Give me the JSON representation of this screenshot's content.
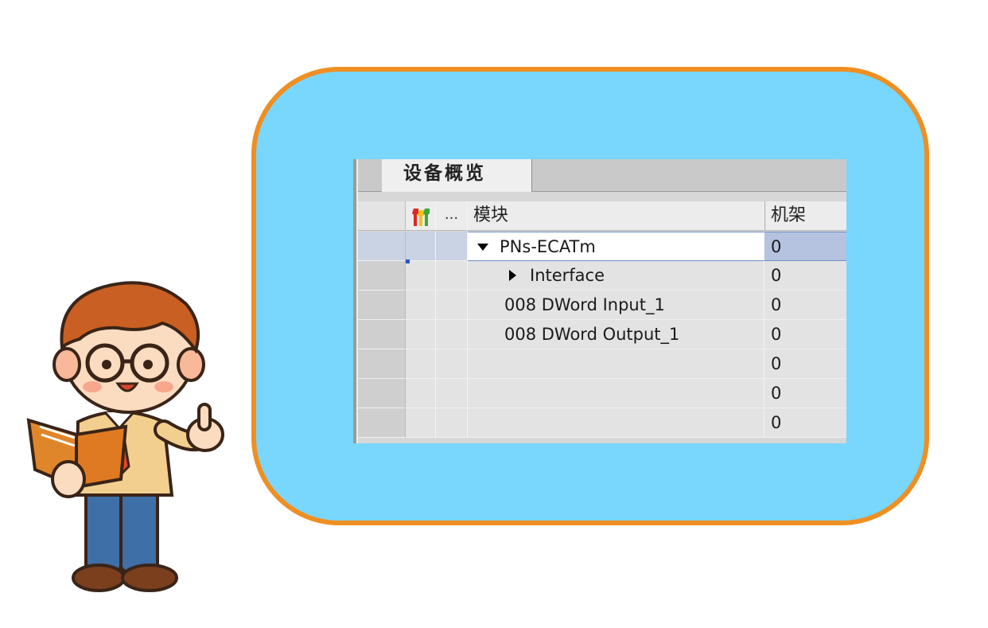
{
  "panel": {
    "tab_title": "设备概览",
    "columns": {
      "icon": "wrench-icon",
      "dots": "...",
      "module": "模块",
      "rack": "机架"
    },
    "rows": [
      {
        "module": "PNs-ECATm",
        "rack": "0",
        "expander": "expanded",
        "selected": true
      },
      {
        "module": "Interface",
        "rack": "0",
        "expander": "collapsed",
        "selected": false
      },
      {
        "module": "008 DWord Input_1",
        "rack": "0",
        "expander": "none",
        "selected": false
      },
      {
        "module": "008 DWord Output_1",
        "rack": "0",
        "expander": "none",
        "selected": false
      },
      {
        "module": "",
        "rack": "0",
        "expander": "none",
        "selected": false
      },
      {
        "module": "",
        "rack": "0",
        "expander": "none",
        "selected": false
      },
      {
        "module": "",
        "rack": "0",
        "expander": "none",
        "selected": false
      }
    ]
  },
  "colors": {
    "bubble_fill": "#79d6fd",
    "bubble_border": "#ef8f22",
    "selection_blue": "#b5c3e0"
  }
}
